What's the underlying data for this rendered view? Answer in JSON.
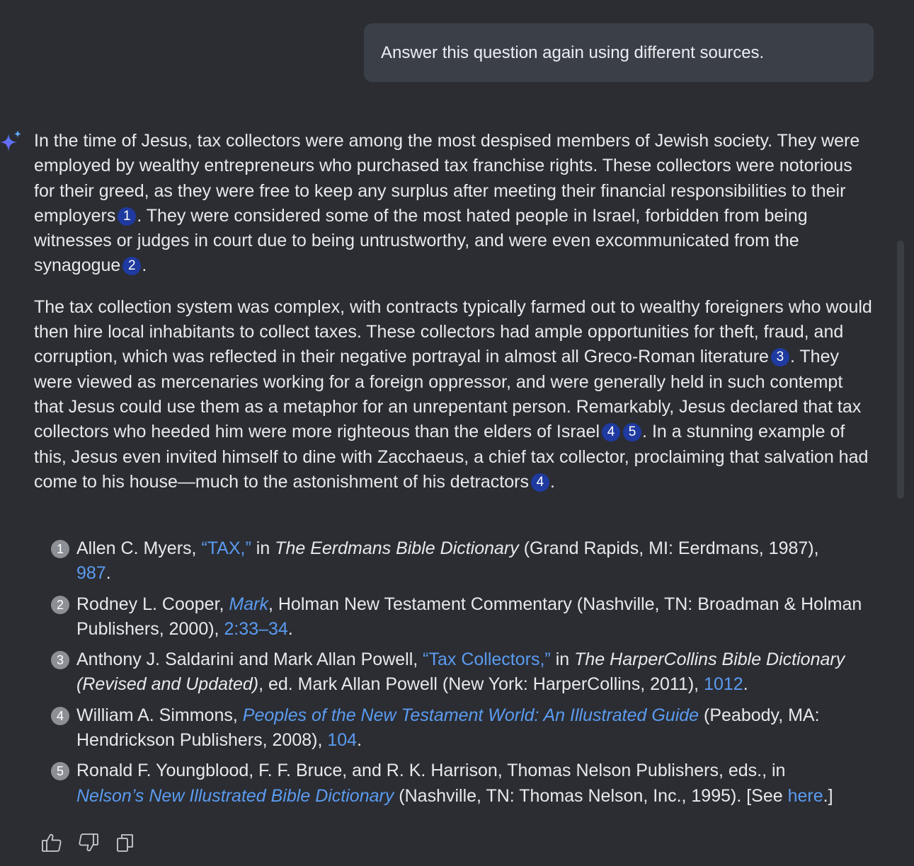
{
  "user_message": "Answer this question again using different sources.",
  "answer": {
    "p1": {
      "s1": "In the time of Jesus, tax collectors were among the most despised members of Jewish society. They were employed by wealthy entrepreneurs who purchased tax franchise rights. These collectors were notorious for their greed, as they were free to keep any surplus after meeting their financial responsibilities to their employers",
      "c1": "1",
      "s2": ". They were considered some of the most hated people in Israel, forbidden from being witnesses or judges in court due to being untrustworthy, and were even excommunicated from the synagogue",
      "c2": "2",
      "s3": "."
    },
    "p2": {
      "s1": "The tax collection system was complex, with contracts typically farmed out to wealthy foreigners who would then hire local inhabitants to collect taxes. These collectors had ample opportunities for theft, fraud, and corruption, which was reflected in their negative portrayal in almost all Greco-Roman literature",
      "c1": "3",
      "s2": ". They were viewed as mercenaries working for a foreign oppressor, and were generally held in such contempt that Jesus could use them as a metaphor for an unrepentant person. Remarkably, Jesus declared that tax collectors who heeded him were more righteous than the elders of Israel",
      "c2": "4",
      "c3": "5",
      "s3": ". In a stunning example of this, Jesus even invited himself to dine with Zacchaeus, a chief tax collector, proclaiming that salvation had come to his house—much to the astonishment of his detractors",
      "c4": "4",
      "s4": "."
    }
  },
  "references": [
    {
      "num": "1",
      "author": "Allen C. Myers, ",
      "link": "“TAX,”",
      "mid": " in ",
      "book": "The Eerdmans Bible Dictionary",
      "rest": " (Grand Rapids, MI: Eerdmans, 1987),",
      "page": "987",
      "end": "."
    },
    {
      "num": "2",
      "author": "Rodney L. Cooper, ",
      "link": "Mark",
      "rest": ", Holman New Testament Commentary (Nashville, TN: Broadman & Holman Publishers, 2000), ",
      "page": "2:33–34",
      "end": "."
    },
    {
      "num": "3",
      "author": "Anthony J. Saldarini and Mark Allan Powell, ",
      "link": "“Tax Collectors,”",
      "mid": " in ",
      "book": "The HarperCollins Bible Dictionary (Revised and Updated)",
      "rest": ", ed. Mark Allan Powell (New York: HarperCollins, 2011), ",
      "page": "1012",
      "end": "."
    },
    {
      "num": "4",
      "author": "William A. Simmons, ",
      "link": "Peoples of the New Testament World: An Illustrated Guide",
      "rest": " (Peabody, MA: Hendrickson Publishers, 2008), ",
      "page": "104",
      "end": "."
    },
    {
      "num": "5",
      "author": "Ronald F. Youngblood, F. F. Bruce, and R. K. Harrison, Thomas Nelson Publishers, eds., in ",
      "link": "Nelson’s New Illustrated Bible Dictionary",
      "rest": " (Nashville, TN: Thomas Nelson, Inc., 1995). [See ",
      "page": "here",
      "end": ".]"
    }
  ],
  "icons": {
    "sparkle": "ai-sparkle-icon",
    "thumbs_up": "thumbs-up-icon",
    "thumbs_down": "thumbs-down-icon",
    "copy": "copy-icon"
  },
  "colors": {
    "background": "#2b2d33",
    "bubble": "#3b3f48",
    "link": "#5b9bf0",
    "citation_badge": "#1f3aa0"
  }
}
